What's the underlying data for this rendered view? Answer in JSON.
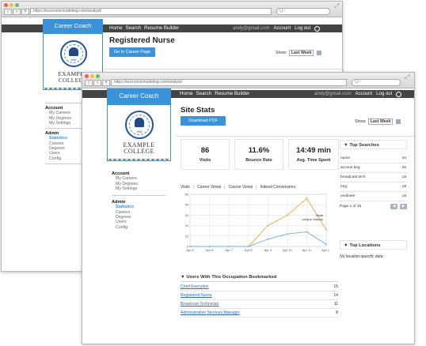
{
  "browser": {
    "back_url": "https://economicmodeling.com/analyst/",
    "front_url": "https://economicmodeling.com/analyst/",
    "search_placeholder": "Q~"
  },
  "app": {
    "brand_title": "Career Coach",
    "college_name_line1": "EXAMPLE",
    "college_name_line2": "COLLEGE",
    "crest_year": "1961",
    "nav": [
      "Home",
      "Search",
      "Resume Builder"
    ],
    "user_email": "andy@gmail.com",
    "account_label": "Account",
    "logout_label": "Log out"
  },
  "sidebar": {
    "account_title": "Account",
    "account_items": [
      "My Careers",
      "My Degrees",
      "My Settings"
    ],
    "admin_title": "Admin",
    "admin_items": [
      "Statistics",
      "Careers",
      "Degrees",
      "Users",
      "Config"
    ]
  },
  "back_window": {
    "title": "Registered Nurse",
    "button": "Go to Career Page",
    "show_label": "Show:",
    "show_value": "Last Week"
  },
  "front_window": {
    "title": "Site Stats",
    "button": "Download PDF",
    "show_label": "Show:",
    "show_value": "Last Week"
  },
  "stats": [
    {
      "value": "86",
      "label": "Visits"
    },
    {
      "value": "11.6%",
      "label": "Bounce Rate"
    },
    {
      "value": "14:49 min",
      "label": "Avg. Time Spent"
    }
  ],
  "tabs": [
    "Visits",
    "Career Views",
    "Course Views",
    "Indeed Conversions"
  ],
  "chart_data": {
    "type": "line",
    "x": [
      "Apr 5",
      "Apr 6",
      "Apr 7",
      "Apr 8",
      "Apr 9",
      "Apr 10",
      "Apr 11",
      "Apr 12"
    ],
    "series": [
      {
        "name": "Visits",
        "values": [
          0,
          0,
          0,
          0,
          20,
          30,
          46,
          16
        ]
      },
      {
        "name": "Unique Visitors",
        "values": [
          0,
          0,
          0,
          0,
          7,
          12,
          14,
          2
        ]
      }
    ],
    "yticks": [
      0,
      10,
      20,
      30,
      40,
      50
    ],
    "ylim": [
      0,
      50
    ],
    "colors": {
      "Visits": "#f0a83d",
      "Unique Visitors": "#6aaede"
    },
    "legend": "top-right"
  },
  "top_searches": {
    "title": "Top Searches",
    "rows": [
      {
        "term": "nurse",
        "count": "44"
      },
      {
        "term": "accoun ting",
        "count": "25"
      },
      {
        "term": "broadcast tech",
        "count": "18"
      },
      {
        "term": "eng",
        "count": "18"
      },
      {
        "term": "endineer",
        "count": "18"
      }
    ],
    "page_label": "Page 1 of 15"
  },
  "top_locations": {
    "title": "Top Locations",
    "empty_text": "No location-specific data."
  },
  "bookmarks": {
    "title": "Users With This Occupation Bookmarked",
    "rows": [
      {
        "name": "Chief Executive",
        "count": "15"
      },
      {
        "name": "Registered Nurse",
        "count": "14"
      },
      {
        "name": "Broadcast Technician",
        "count": "11"
      },
      {
        "name": "Administrative Services Manager",
        "count": "8"
      }
    ]
  },
  "colors": {
    "accent": "#3a93d8",
    "topbar": "#444444"
  }
}
